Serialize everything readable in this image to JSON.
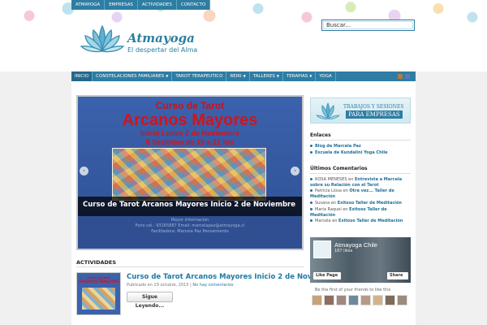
{
  "top_nav": [
    "ATMAYOGA",
    "EMPRESAS",
    "ACTIVIDADES",
    "CONTACTO"
  ],
  "logo": {
    "name": "Atmayoga",
    "tagline": "El despertar del Alma"
  },
  "search": {
    "placeholder": "Buscar..."
  },
  "main_nav": [
    {
      "label": "INICIO",
      "dropdown": false
    },
    {
      "label": "CONSTELACIONES FAMILIARES",
      "dropdown": true
    },
    {
      "label": "TAROT TERAPEUTICO",
      "dropdown": false
    },
    {
      "label": "REIKI",
      "dropdown": true
    },
    {
      "label": "TALLERES",
      "dropdown": true
    },
    {
      "label": "TERAPIAS",
      "dropdown": true
    },
    {
      "label": "YOGA",
      "dropdown": false
    }
  ],
  "slider": {
    "line1": "Curso de Tarot",
    "line2": "Arcanos Mayores",
    "line3": "Inicio Lunes 2 de Noviembre",
    "line4": "8 Sesiones de 19 a 21 hrs",
    "caption": "Curso de Tarot Arcanos Mayores Inicio 2 de Noviembre",
    "footer_lines": [
      "Mayor informacion",
      "Fono cel.: 93165887 Email: marcelapaz@atmayoga.cl",
      "Facilitadora: Marcela Paz Pensamiento"
    ],
    "prev": "‹",
    "next": "›"
  },
  "activities": {
    "heading": "ACTIVIDADES",
    "post_title": "Curso de Tarot Arcanos Mayores Inicio 2 de Noviembre",
    "post_date": "Publicado en 29 octubre, 2015",
    "post_comments": "No hay comentarios",
    "read_more": "Sigue Leyendo...",
    "thumb_line1": "Curso de Tarot",
    "thumb_line2": "Arcanos Mayores"
  },
  "sidebar": {
    "banner_line1": "TRABAJOS Y SESIONES",
    "banner_line2": "PARA EMPRESAS",
    "links_heading": "Enlaces",
    "links": [
      "Blog de Marcela Paz",
      "Escuela de Kundalini Yoga Chile"
    ],
    "comments_heading": "Últimos Comentarios",
    "comments": [
      {
        "author": "ROSA MENESES",
        "link": "Entrevista a Marcela sobre su Relación con el Tarot"
      },
      {
        "author": "Patricia Llosa",
        "link": "Otra vez... Taller de Meditación"
      },
      {
        "author": "Susana",
        "link": "Exitoso Taller de Meditación"
      },
      {
        "author": "Maria Raquel",
        "link": "Exitoso Taller de Meditación"
      },
      {
        "author": "Marcela",
        "link": "Exitoso Taller de Meditación"
      }
    ],
    "comments_on": "en",
    "fb": {
      "name": "Atmayoga Chile",
      "likes": "187 likes",
      "like_button": "Like Page",
      "share_button": "Share",
      "friends_text": "Be the first of your friends to like this"
    }
  },
  "colors": {
    "brand": "#2e7da3",
    "link": "#1e7aa6",
    "slider_title": "#d0141e"
  }
}
